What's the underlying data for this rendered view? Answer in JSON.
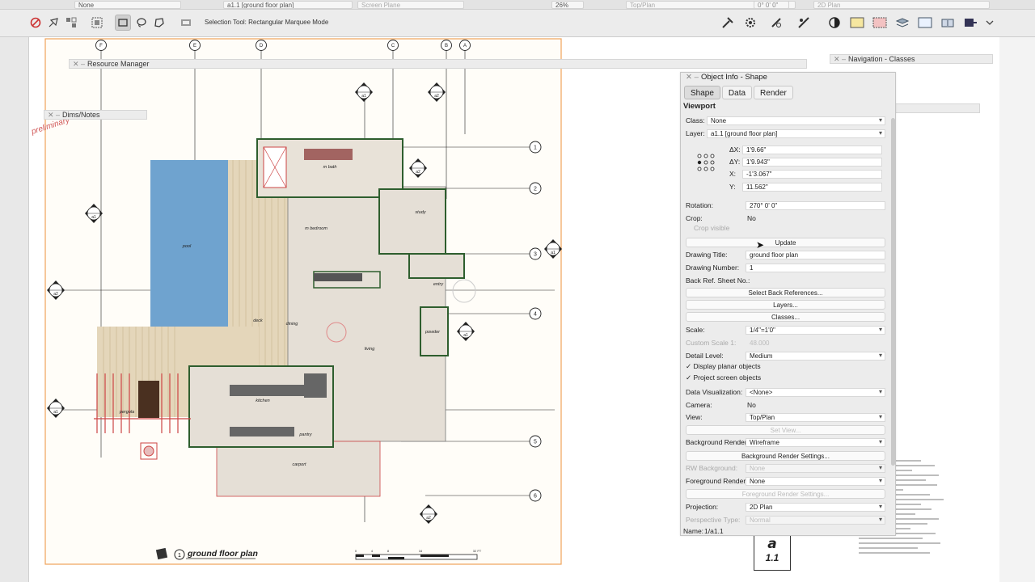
{
  "toolbar": {
    "class_value": "None",
    "layer_value": "a1.1 [ground floor plan]",
    "plane_value": "Screen Plane",
    "zoom_value": "26%",
    "view_value": "Top/Plan",
    "render_value": "2D Plan",
    "rotation_value": "0° 0' 0\"",
    "mode_text": "Selection Tool: Rectangular Marquee Mode"
  },
  "palettes": {
    "resource_manager": "Resource Manager",
    "dims_notes": "Dims/Notes",
    "navigation": "Navigation - Classes"
  },
  "drawing": {
    "column_markers": [
      "F",
      "E",
      "D",
      "C",
      "B",
      "A"
    ],
    "row_markers": [
      "1",
      "2",
      "3",
      "4",
      "5",
      "6"
    ],
    "section_tags": [
      "a1",
      "a2",
      "a1",
      "a2",
      "a1",
      "a1",
      "a2",
      "a1",
      "a2"
    ],
    "room_labels": [
      "m bath",
      "m bedroom",
      "study",
      "pool",
      "deck",
      "dining",
      "living",
      "entry",
      "powder",
      "kitchen",
      "pantry",
      "pergola",
      "carport"
    ],
    "stamp": "preliminary",
    "drawing_title": "ground floor plan",
    "drawing_number": "1",
    "scale_ticks": [
      "0",
      "4",
      "8",
      "16",
      "32 FT"
    ],
    "sheet_letter": "a",
    "sheet_number": "1.1"
  },
  "object_info": {
    "title": "Object Info - Shape",
    "tabs": [
      "Shape",
      "Data",
      "Render"
    ],
    "section": "Viewport",
    "labels": {
      "class": "Class:",
      "layer": "Layer:",
      "dx": "ΔX:",
      "dy": "ΔY:",
      "x": "X:",
      "y": "Y:",
      "rotation": "Rotation:",
      "crop": "Crop:",
      "crop_visible": "Crop visible",
      "drawing_title": "Drawing Title:",
      "drawing_number": "Drawing Number:",
      "back_ref": "Back Ref. Sheet No.:",
      "scale": "Scale:",
      "custom_scale": "Custom Scale 1:",
      "detail_level": "Detail Level:",
      "data_viz": "Data Visualization:",
      "camera": "Camera:",
      "view": "View:",
      "bg_render": "Background Render:",
      "rw_background": "RW Background:",
      "fg_render": "Foreground Render:",
      "projection": "Projection:",
      "perspective": "Perspective Type:",
      "name": "Name:"
    },
    "values": {
      "class": "None",
      "layer": "a1.1 [ground floor plan]",
      "dx": "1'9.66\"",
      "dy": "1'9.943\"",
      "x": "-1'3.067\"",
      "y": "11.562\"",
      "rotation": "270° 0' 0\"",
      "crop": "No",
      "drawing_title": "ground floor plan",
      "drawing_number": "1",
      "scale": "1/4\"=1'0\"",
      "custom_scale": "48.000",
      "detail_level": "Medium",
      "data_viz": "<None>",
      "camera": "No",
      "view": "Top/Plan",
      "bg_render": "Wireframe",
      "rw_background": "None",
      "fg_render": "None",
      "projection": "2D Plan",
      "perspective": "Normal",
      "name": "1/a1.1"
    },
    "buttons": {
      "update": "Update",
      "select_back_refs": "Select Back References...",
      "layers": "Layers...",
      "classes": "Classes...",
      "set_view": "Set View...",
      "bg_render_settings": "Background Render Settings...",
      "fg_render_settings": "Foreground Render Settings..."
    },
    "checkboxes": {
      "display_planar": "Display planar objects",
      "project_screen": "Project screen objects"
    }
  },
  "colors": {
    "pool": "#6fa3cf",
    "deck": "#d9c6a5",
    "walls": "#2e5e2e",
    "highlight": "#c44"
  }
}
